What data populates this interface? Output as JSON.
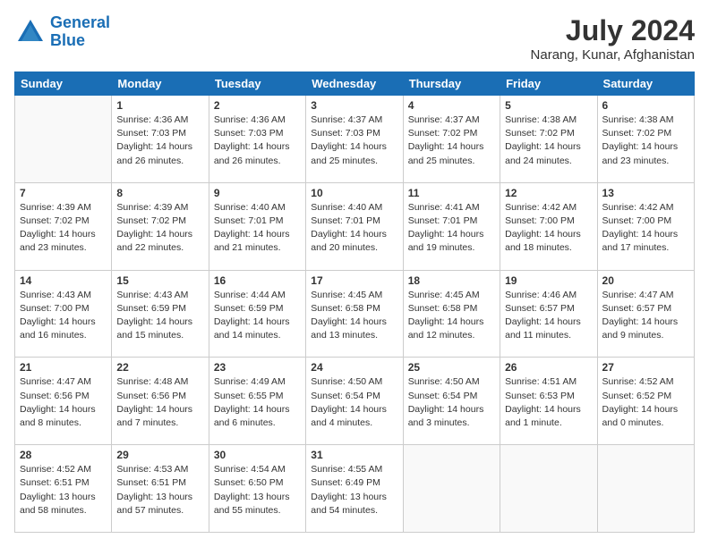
{
  "header": {
    "logo": {
      "line1": "General",
      "line2": "Blue"
    },
    "title": "July 2024",
    "location": "Narang, Kunar, Afghanistan"
  },
  "days_of_week": [
    "Sunday",
    "Monday",
    "Tuesday",
    "Wednesday",
    "Thursday",
    "Friday",
    "Saturday"
  ],
  "weeks": [
    [
      {
        "day": "",
        "info": ""
      },
      {
        "day": "1",
        "info": "Sunrise: 4:36 AM\nSunset: 7:03 PM\nDaylight: 14 hours\nand 26 minutes."
      },
      {
        "day": "2",
        "info": "Sunrise: 4:36 AM\nSunset: 7:03 PM\nDaylight: 14 hours\nand 26 minutes."
      },
      {
        "day": "3",
        "info": "Sunrise: 4:37 AM\nSunset: 7:03 PM\nDaylight: 14 hours\nand 25 minutes."
      },
      {
        "day": "4",
        "info": "Sunrise: 4:37 AM\nSunset: 7:02 PM\nDaylight: 14 hours\nand 25 minutes."
      },
      {
        "day": "5",
        "info": "Sunrise: 4:38 AM\nSunset: 7:02 PM\nDaylight: 14 hours\nand 24 minutes."
      },
      {
        "day": "6",
        "info": "Sunrise: 4:38 AM\nSunset: 7:02 PM\nDaylight: 14 hours\nand 23 minutes."
      }
    ],
    [
      {
        "day": "7",
        "info": "Sunrise: 4:39 AM\nSunset: 7:02 PM\nDaylight: 14 hours\nand 23 minutes."
      },
      {
        "day": "8",
        "info": "Sunrise: 4:39 AM\nSunset: 7:02 PM\nDaylight: 14 hours\nand 22 minutes."
      },
      {
        "day": "9",
        "info": "Sunrise: 4:40 AM\nSunset: 7:01 PM\nDaylight: 14 hours\nand 21 minutes."
      },
      {
        "day": "10",
        "info": "Sunrise: 4:40 AM\nSunset: 7:01 PM\nDaylight: 14 hours\nand 20 minutes."
      },
      {
        "day": "11",
        "info": "Sunrise: 4:41 AM\nSunset: 7:01 PM\nDaylight: 14 hours\nand 19 minutes."
      },
      {
        "day": "12",
        "info": "Sunrise: 4:42 AM\nSunset: 7:00 PM\nDaylight: 14 hours\nand 18 minutes."
      },
      {
        "day": "13",
        "info": "Sunrise: 4:42 AM\nSunset: 7:00 PM\nDaylight: 14 hours\nand 17 minutes."
      }
    ],
    [
      {
        "day": "14",
        "info": "Sunrise: 4:43 AM\nSunset: 7:00 PM\nDaylight: 14 hours\nand 16 minutes."
      },
      {
        "day": "15",
        "info": "Sunrise: 4:43 AM\nSunset: 6:59 PM\nDaylight: 14 hours\nand 15 minutes."
      },
      {
        "day": "16",
        "info": "Sunrise: 4:44 AM\nSunset: 6:59 PM\nDaylight: 14 hours\nand 14 minutes."
      },
      {
        "day": "17",
        "info": "Sunrise: 4:45 AM\nSunset: 6:58 PM\nDaylight: 14 hours\nand 13 minutes."
      },
      {
        "day": "18",
        "info": "Sunrise: 4:45 AM\nSunset: 6:58 PM\nDaylight: 14 hours\nand 12 minutes."
      },
      {
        "day": "19",
        "info": "Sunrise: 4:46 AM\nSunset: 6:57 PM\nDaylight: 14 hours\nand 11 minutes."
      },
      {
        "day": "20",
        "info": "Sunrise: 4:47 AM\nSunset: 6:57 PM\nDaylight: 14 hours\nand 9 minutes."
      }
    ],
    [
      {
        "day": "21",
        "info": "Sunrise: 4:47 AM\nSunset: 6:56 PM\nDaylight: 14 hours\nand 8 minutes."
      },
      {
        "day": "22",
        "info": "Sunrise: 4:48 AM\nSunset: 6:56 PM\nDaylight: 14 hours\nand 7 minutes."
      },
      {
        "day": "23",
        "info": "Sunrise: 4:49 AM\nSunset: 6:55 PM\nDaylight: 14 hours\nand 6 minutes."
      },
      {
        "day": "24",
        "info": "Sunrise: 4:50 AM\nSunset: 6:54 PM\nDaylight: 14 hours\nand 4 minutes."
      },
      {
        "day": "25",
        "info": "Sunrise: 4:50 AM\nSunset: 6:54 PM\nDaylight: 14 hours\nand 3 minutes."
      },
      {
        "day": "26",
        "info": "Sunrise: 4:51 AM\nSunset: 6:53 PM\nDaylight: 14 hours\nand 1 minute."
      },
      {
        "day": "27",
        "info": "Sunrise: 4:52 AM\nSunset: 6:52 PM\nDaylight: 14 hours\nand 0 minutes."
      }
    ],
    [
      {
        "day": "28",
        "info": "Sunrise: 4:52 AM\nSunset: 6:51 PM\nDaylight: 13 hours\nand 58 minutes."
      },
      {
        "day": "29",
        "info": "Sunrise: 4:53 AM\nSunset: 6:51 PM\nDaylight: 13 hours\nand 57 minutes."
      },
      {
        "day": "30",
        "info": "Sunrise: 4:54 AM\nSunset: 6:50 PM\nDaylight: 13 hours\nand 55 minutes."
      },
      {
        "day": "31",
        "info": "Sunrise: 4:55 AM\nSunset: 6:49 PM\nDaylight: 13 hours\nand 54 minutes."
      },
      {
        "day": "",
        "info": ""
      },
      {
        "day": "",
        "info": ""
      },
      {
        "day": "",
        "info": ""
      }
    ]
  ]
}
